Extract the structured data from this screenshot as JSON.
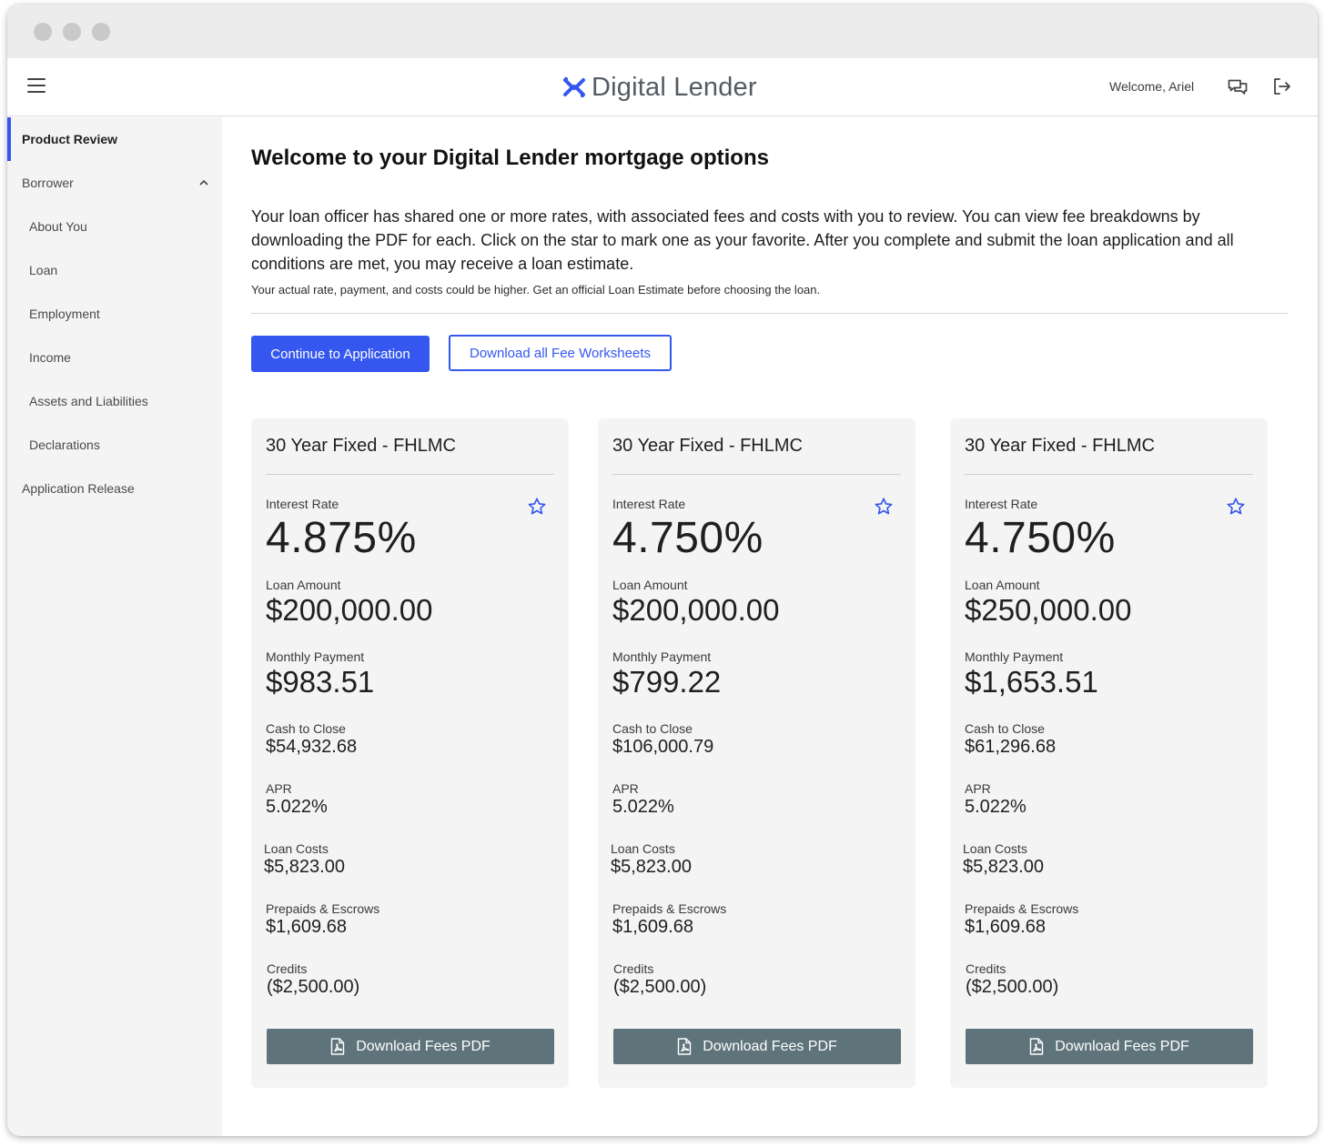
{
  "app": {
    "name": "Digital Lender"
  },
  "header": {
    "welcome": "Welcome, Ariel"
  },
  "icons": {
    "menu": "hamburger-menu-icon",
    "chat": "chat-bubbles-icon",
    "logout": "logout-icon",
    "favorite": "star-outline-icon",
    "pdf": "pdf-file-icon",
    "expand": "chevron-up-icon"
  },
  "colors": {
    "accent": "#3557f0",
    "download_button": "#5f737b",
    "sidebar": "#f4f4f4",
    "card": "#f4f4f4"
  },
  "sidebar": {
    "items": [
      {
        "label": "Product Review",
        "active": true
      },
      {
        "label": "Borrower",
        "expanded": true
      },
      {
        "label": "About You"
      },
      {
        "label": "Loan"
      },
      {
        "label": "Employment"
      },
      {
        "label": "Income"
      },
      {
        "label": "Assets and Liabilities"
      },
      {
        "label": "Declarations"
      },
      {
        "label": "Application Release"
      }
    ]
  },
  "main": {
    "title": "Welcome to your Digital Lender mortgage options",
    "intro": "Your loan officer has shared one or more rates, with associated fees and costs with you to review. You can view fee breakdowns by downloading the PDF for each. Click on the star to mark one as your favorite. After you complete and submit the loan application and all conditions are met, you may receive a loan estimate.",
    "disclaimer": "Your actual rate, payment, and costs could be higher. Get an official Loan Estimate before choosing the loan.",
    "continue_label": "Continue to Application",
    "download_all_label": "Download all Fee Worksheets"
  },
  "labels": {
    "interest_rate": "Interest Rate",
    "loan_amount": "Loan Amount",
    "monthly_payment": "Monthly Payment",
    "cash_to_close": "Cash to Close",
    "apr": "APR",
    "loan_costs": "Loan Costs",
    "prepaids": "Prepaids & Escrows",
    "credits": "Credits",
    "download_pdf": "Download Fees PDF"
  },
  "cards": [
    {
      "title": "30 Year Fixed - FHLMC",
      "interest_rate": "4.875%",
      "loan_amount": "$200,000.00",
      "monthly_payment": "$983.51",
      "cash_to_close": "$54,932.68",
      "apr": "5.022%",
      "loan_costs": "$5,823.00",
      "prepaids": "$1,609.68",
      "credits": "($2,500.00)"
    },
    {
      "title": "30 Year Fixed - FHLMC",
      "interest_rate": "4.750%",
      "loan_amount": "$200,000.00",
      "monthly_payment": "$799.22",
      "cash_to_close": "$106,000.79",
      "apr": "5.022%",
      "loan_costs": "$5,823.00",
      "prepaids": "$1,609.68",
      "credits": "($2,500.00)"
    },
    {
      "title": "30 Year Fixed - FHLMC",
      "interest_rate": "4.750%",
      "loan_amount": "$250,000.00",
      "monthly_payment": "$1,653.51",
      "cash_to_close": "$61,296.68",
      "apr": "5.022%",
      "loan_costs": "$5,823.00",
      "prepaids": "$1,609.68",
      "credits": "($2,500.00)"
    }
  ]
}
